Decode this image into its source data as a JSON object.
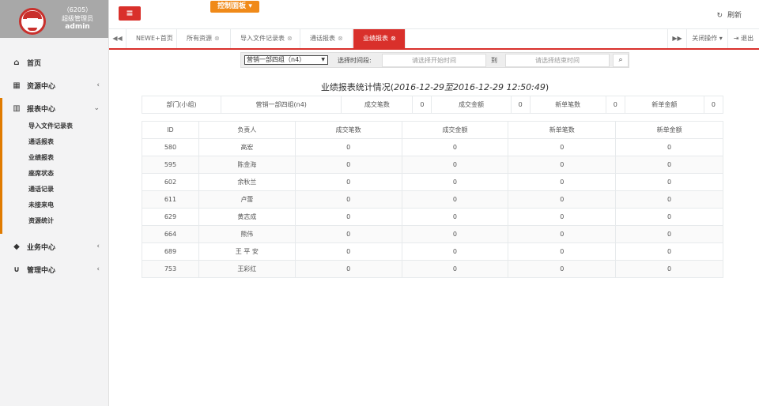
{
  "profile": {
    "line1": "（6205）",
    "line2": "超级管理员",
    "line3": "admin"
  },
  "sidebar": {
    "items": [
      {
        "label": "首页",
        "icon": "home-icon"
      },
      {
        "label": "资源中心",
        "icon": "table-icon"
      },
      {
        "label": "报表中心",
        "icon": "bar-chart-icon"
      },
      {
        "label": "业务中心",
        "icon": "graduation-cap-icon"
      },
      {
        "label": "管理中心",
        "icon": "magnet-icon"
      }
    ],
    "sub_items": [
      "导入文件记录表",
      "通话报表",
      "业绩报表",
      "座席状态",
      "通话记录",
      "未接来电",
      "资源统计"
    ]
  },
  "topbar": {
    "control_panel": "控制面板",
    "refresh": "刷新"
  },
  "tabs": [
    "NEWE+首页",
    "所有资源",
    "导入文件记录表",
    "通话报表",
    "业绩报表"
  ],
  "tabs_right": {
    "close_ops": "关闭操作",
    "logout": "退出"
  },
  "search": {
    "dept_selected": "营销一部四组（n4）",
    "time_label": "选择时间段:",
    "start_placeholder": "请选择开始时间",
    "to_label": "到",
    "end_placeholder": "请选择结束时间"
  },
  "report_title_prefix": "业绩报表统计情况(",
  "report_title_range": "2016-12-29至2016-12-29 12:50:49",
  "report_title_suffix": ")",
  "summary": [
    "部门(小组)",
    "营销一部四组(n4)",
    "成交笔数",
    "0",
    "成交金额",
    "0",
    "新单笔数",
    "0",
    "新单金额",
    "0"
  ],
  "table": {
    "headers": [
      "ID",
      "负责人",
      "成交笔数",
      "成交金额",
      "新单笔数",
      "新单金额"
    ],
    "rows": [
      [
        "580",
        "高宏",
        "0",
        "0",
        "0",
        "0"
      ],
      [
        "595",
        "陈金海",
        "0",
        "0",
        "0",
        "0"
      ],
      [
        "602",
        "余秋兰",
        "0",
        "0",
        "0",
        "0"
      ],
      [
        "611",
        "卢蕾",
        "0",
        "0",
        "0",
        "0"
      ],
      [
        "629",
        "黄志成",
        "0",
        "0",
        "0",
        "0"
      ],
      [
        "664",
        "熊伟",
        "0",
        "0",
        "0",
        "0"
      ],
      [
        "689",
        "王 平 安",
        "0",
        "0",
        "0",
        "0"
      ],
      [
        "753",
        "王彩红",
        "0",
        "0",
        "0",
        "0"
      ]
    ]
  },
  "colors": {
    "brand_red": "#d9302b",
    "accent_orange": "#f08a19"
  }
}
